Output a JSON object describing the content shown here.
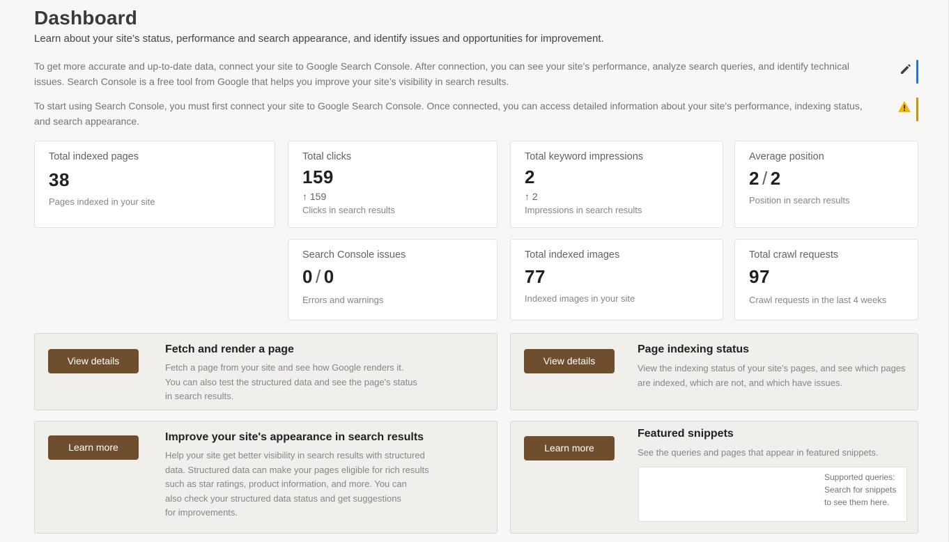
{
  "header": {
    "title": "Dashboard",
    "subtitle": "Learn about your site’s status, performance and search appearance, and identify issues and opportunities for improvement."
  },
  "notices": [
    {
      "text": "To get more accurate and up-to-date data, connect your site to Google Search Console. After connection, you can see your site's performance, analyze search queries, and identify technical issues. Search Console is a free tool from Google that helps you improve your site’s visibility in search results.",
      "icon": "edit-icon",
      "accent": "#1a73e8"
    },
    {
      "text": "To start using Search Console, you must first connect your site to Google Search Console. Once connected, you can access detailed information about your site's performance, indexing status, and search appearance.",
      "icon": "warning-icon",
      "accent": "#c99400"
    }
  ],
  "stats": {
    "indexed_pages": {
      "label": "Total indexed pages",
      "value": "38",
      "desc": "Pages indexed in your site"
    },
    "clicks": {
      "label": "Total clicks",
      "value": "159",
      "delta": "↑ 159",
      "desc": "Clicks in search results"
    },
    "impressions": {
      "label": "Total keyword impressions",
      "value": "2",
      "delta": "↑ 2",
      "desc": "Impressions in search results"
    },
    "position": {
      "label": "Average position",
      "value_a": "2",
      "value_b": "2",
      "desc": "Position in search results"
    },
    "issues": {
      "label": "Search Console issues",
      "value_a": "0",
      "value_b": "0",
      "desc": "Errors and warnings"
    },
    "indexed_images": {
      "label": "Total indexed images",
      "value": "77",
      "desc": "Indexed images in your site"
    },
    "crawl_requests": {
      "label": "Total crawl requests",
      "value": "97",
      "desc": "Crawl requests in the last 4 weeks"
    }
  },
  "panels": {
    "fetch": {
      "button": "View details",
      "title": "Fetch and render a page",
      "lines": [
        "Fetch a page from your site and see how Google renders it.",
        "You can also test the structured data and see the page's status",
        "in search results."
      ]
    },
    "indexing": {
      "button": "View details",
      "title": "Page indexing status",
      "lines": [
        "View the indexing status of your site's pages, and see which pages",
        "are indexed, which are not, and which have issues."
      ]
    },
    "appearance": {
      "button": "Learn more",
      "title": "Improve your site's appearance in search results",
      "lines": [
        "Help your site get better visibility in search results with structured",
        "data. Structured data can make your pages eligible for rich results",
        "such as star ratings, product information, and more. You can",
        "also check your structured data status and get suggestions",
        "for improvements."
      ]
    },
    "snippets": {
      "button": "Learn more",
      "title": "Featured snippets",
      "text": "See the queries and pages that appear in featured snippets.",
      "box_lines": [
        "Supported queries:",
        "Search for snippets",
        "to see them here."
      ]
    }
  },
  "colors": {
    "button_bg": "#6e4e2c",
    "panel_bg": "#f1efec",
    "card_bg": "#ffffff"
  }
}
